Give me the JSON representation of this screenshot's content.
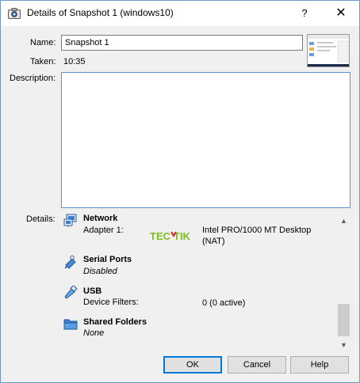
{
  "window": {
    "title": "Details of Snapshot 1 (windows10)",
    "help_glyph": "?",
    "close_glyph": "✕"
  },
  "form": {
    "name_label": "Name:",
    "name_value": "Snapshot 1",
    "taken_label": "Taken:",
    "taken_value": "10:35",
    "description_label": "Description:",
    "description_value": "",
    "details_label": "Details:"
  },
  "details": {
    "network": {
      "title": "Network",
      "key": "Adapter 1:",
      "value_line1": "Intel PRO/1000 MT Desktop",
      "value_line2": "(NAT)",
      "icon": "network-icon"
    },
    "serial": {
      "title": "Serial Ports",
      "status": "Disabled",
      "icon": "serial-port-icon"
    },
    "usb": {
      "title": "USB",
      "key": "Device Filters:",
      "value": "0 (0 active)",
      "icon": "usb-icon"
    },
    "shared": {
      "title": "Shared Folders",
      "status": "None",
      "icon": "folder-icon"
    }
  },
  "watermark": {
    "text_part1": "TEC",
    "text_part2": "TIK"
  },
  "buttons": {
    "ok": "OK",
    "cancel": "Cancel",
    "help": "Help"
  },
  "colors": {
    "accent": "#0078d7",
    "watermark_green": "#7cbf1e",
    "watermark_red": "#d9232e"
  }
}
